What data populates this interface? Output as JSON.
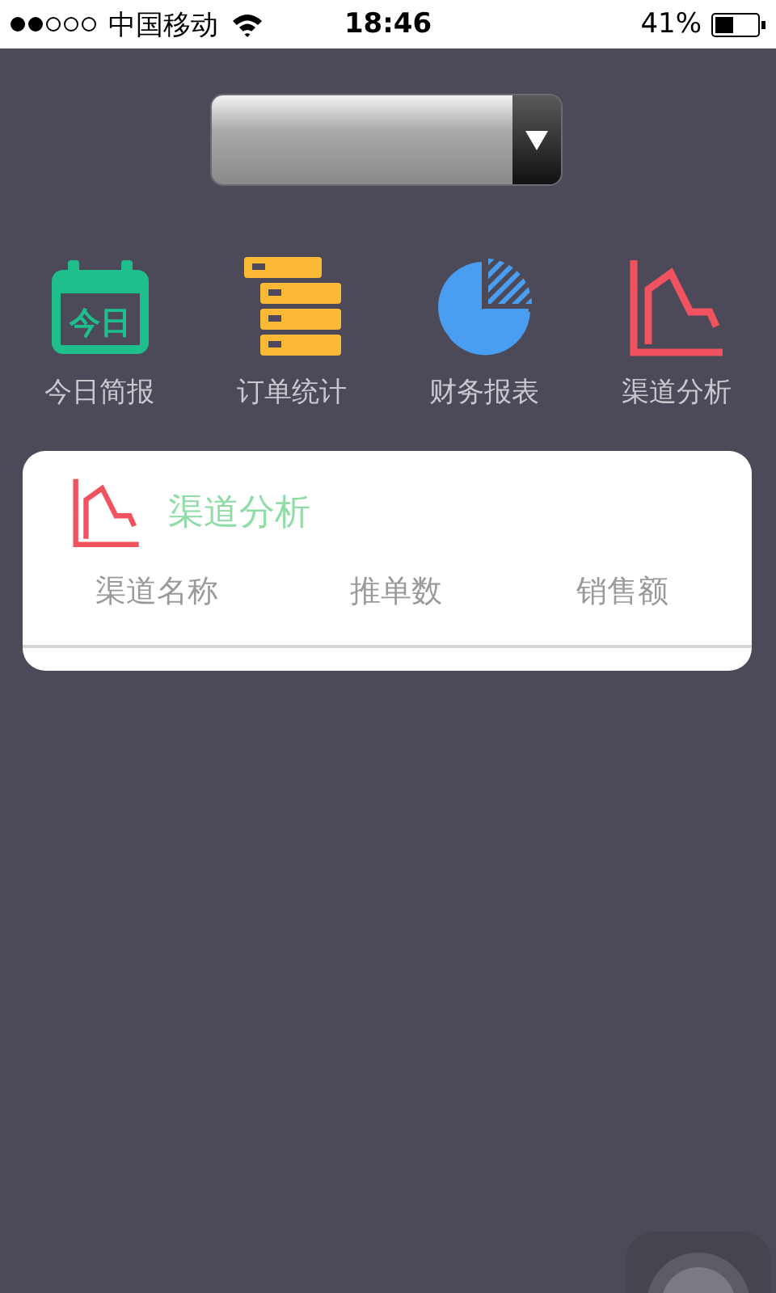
{
  "status_bar": {
    "carrier": "中国移动",
    "time": "18:46",
    "battery": "41%"
  },
  "menu": [
    {
      "kind": "calendar",
      "label": "今日简报",
      "icon_text": "今日"
    },
    {
      "kind": "list",
      "label": "订单统计"
    },
    {
      "kind": "pie",
      "label": "财务报表"
    },
    {
      "kind": "chart",
      "label": "渠道分析"
    }
  ],
  "card": {
    "title": "渠道分析",
    "columns": [
      "渠道名称",
      "推单数",
      "销售额"
    ]
  }
}
